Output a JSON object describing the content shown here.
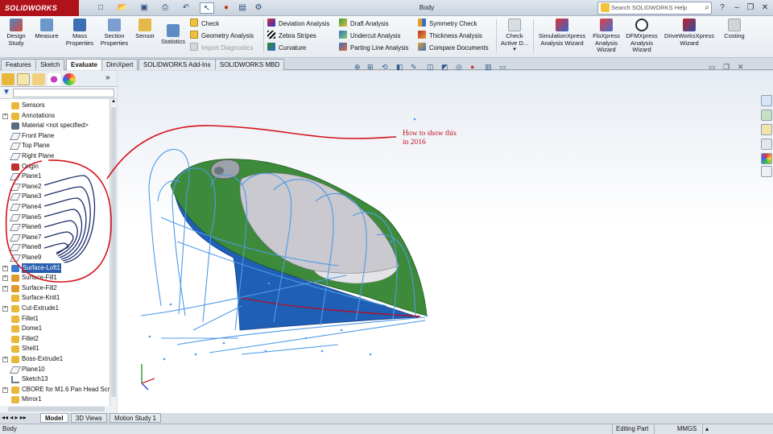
{
  "app": {
    "name": "SOLIDWORKS",
    "window_title": "Body",
    "search_placeholder": "Search SOLIDWORKS Help"
  },
  "ribbon": {
    "design_study": "Design Study",
    "measure": "Measure",
    "mass_properties": "Mass Properties",
    "section_properties": "Section Properties",
    "sensor": "Sensor",
    "statistics": "Statistics",
    "check": "Check",
    "geometry_analysis": "Geometry Analysis",
    "import_diagnostics": "Import Diagnostics",
    "deviation_analysis": "Deviation Analysis",
    "zebra_stripes": "Zebra Stripes",
    "curvature": "Curvature",
    "draft_analysis": "Draft Analysis",
    "undercut_analysis": "Undercut Analysis",
    "parting_line_analysis": "Parting Line Analysis",
    "symmetry_check": "Symmetry Check",
    "thickness_analysis": "Thickness Analysis",
    "compare_documents": "Compare Documents",
    "check_active_document": "Check Active D...",
    "simulationxpress": "SimulationXpress Analysis Wizard",
    "floxpress": "FloXpress Analysis Wizard",
    "dfmxpress": "DFMXpress Analysis Wizard",
    "driveworksxpress": "DriveWorksXpress Wizard",
    "costing": "Costing"
  },
  "command_tabs": [
    "Features",
    "Sketch",
    "Evaluate",
    "DimXpert",
    "SOLIDWORKS Add-Ins",
    "SOLIDWORKS MBD"
  ],
  "active_command_tab": "Evaluate",
  "feature_tree": [
    {
      "label": "Sensors",
      "icon": "sensors-icon",
      "expand": false
    },
    {
      "label": "Annotations",
      "icon": "annotations-icon",
      "expand": true
    },
    {
      "label": "Material <not specified>",
      "icon": "material-icon",
      "expand": false
    },
    {
      "label": "Front Plane",
      "icon": "plane-icon",
      "expand": false
    },
    {
      "label": "Top Plane",
      "icon": "plane-icon",
      "expand": false
    },
    {
      "label": "Right Plane",
      "icon": "plane-icon",
      "expand": false
    },
    {
      "label": "Origin",
      "icon": "origin-icon",
      "expand": false
    },
    {
      "label": "Plane1",
      "icon": "plane-icon",
      "expand": false
    },
    {
      "label": "Plane2",
      "icon": "plane-icon",
      "expand": false
    },
    {
      "label": "Plane3",
      "icon": "plane-icon",
      "expand": false
    },
    {
      "label": "Plane4",
      "icon": "plane-icon",
      "expand": false
    },
    {
      "label": "Plane5",
      "icon": "plane-icon",
      "expand": false
    },
    {
      "label": "Plane6",
      "icon": "plane-icon",
      "expand": false
    },
    {
      "label": "Plane7",
      "icon": "plane-icon",
      "expand": false
    },
    {
      "label": "Plane8",
      "icon": "plane-icon",
      "expand": false
    },
    {
      "label": "Plane9",
      "icon": "plane-icon",
      "expand": false
    },
    {
      "label": "Surface-Loft1",
      "icon": "surface-loft-icon",
      "expand": true,
      "selected": true
    },
    {
      "label": "Surface-Fill1",
      "icon": "surface-fill-icon",
      "expand": true
    },
    {
      "label": "Surface-Fill2",
      "icon": "surface-fill-icon",
      "expand": true
    },
    {
      "label": "Surface-Knit1",
      "icon": "surface-knit-icon",
      "expand": false
    },
    {
      "label": "Cut-Extrude1",
      "icon": "cut-extrude-icon",
      "expand": true
    },
    {
      "label": "Fillet1",
      "icon": "fillet-icon",
      "expand": false
    },
    {
      "label": "Dome1",
      "icon": "dome-icon",
      "expand": false
    },
    {
      "label": "Fillet2",
      "icon": "fillet-icon",
      "expand": false
    },
    {
      "label": "Shell1",
      "icon": "shell-icon",
      "expand": false
    },
    {
      "label": "Boss-Extrude1",
      "icon": "boss-extrude-icon",
      "expand": true
    },
    {
      "label": "Plane10",
      "icon": "plane-icon",
      "expand": false
    },
    {
      "label": "Sketch13",
      "icon": "sketch-icon",
      "expand": false
    },
    {
      "label": "CBORE for M1.6 Pan Head Scre",
      "icon": "hole-wizard-icon",
      "expand": true
    },
    {
      "label": "Mirror1",
      "icon": "mirror-icon",
      "expand": false
    }
  ],
  "bottom_tabs": [
    "Model",
    "3D Views",
    "Motion Study 1"
  ],
  "active_bottom_tab": "Model",
  "annotation_note": [
    "How to show this",
    "in 2016"
  ],
  "status": {
    "left": "Body",
    "mode": "Editing Part",
    "units": "MMGS"
  },
  "colors": {
    "brand_red": "#b0121b",
    "model_green": "#3d8a3a",
    "model_blue": "#1f5fb5",
    "sketch_blue": "#4f9be8",
    "annotation_red": "#d4141c"
  }
}
